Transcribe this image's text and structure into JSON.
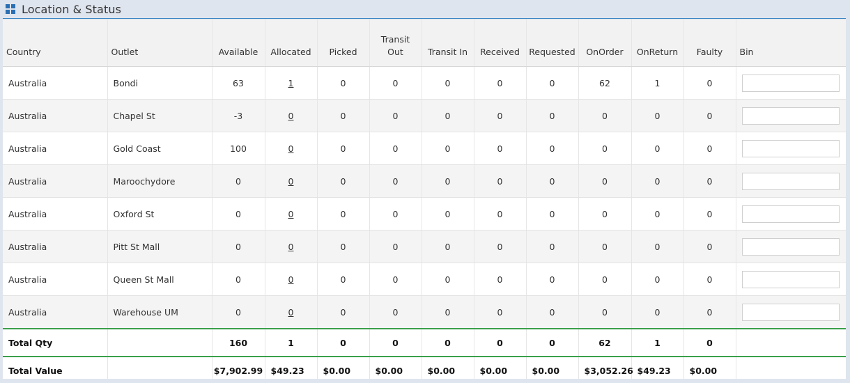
{
  "panel": {
    "title": "Location & Status",
    "icon": "grid-icon"
  },
  "table": {
    "headers": {
      "country": "Country",
      "outlet": "Outlet",
      "available": "Available",
      "allocated": "Allocated",
      "picked": "Picked",
      "transit_out_1": "Transit",
      "transit_out_2": "Out",
      "transit_in": "Transit In",
      "received": "Received",
      "requested": "Requested",
      "onorder": "OnOrder",
      "onreturn": "OnReturn",
      "faulty": "Faulty",
      "bin": "Bin"
    },
    "rows": [
      {
        "country": "Australia",
        "outlet": "Bondi",
        "available": "63",
        "allocated": "1",
        "picked": "0",
        "transit_out": "0",
        "transit_in": "0",
        "received": "0",
        "requested": "0",
        "onorder": "62",
        "onreturn": "1",
        "faulty": "0",
        "bin": ""
      },
      {
        "country": "Australia",
        "outlet": "Chapel St",
        "available": "-3",
        "allocated": "0",
        "picked": "0",
        "transit_out": "0",
        "transit_in": "0",
        "received": "0",
        "requested": "0",
        "onorder": "0",
        "onreturn": "0",
        "faulty": "0",
        "bin": ""
      },
      {
        "country": "Australia",
        "outlet": "Gold Coast",
        "available": "100",
        "allocated": "0",
        "picked": "0",
        "transit_out": "0",
        "transit_in": "0",
        "received": "0",
        "requested": "0",
        "onorder": "0",
        "onreturn": "0",
        "faulty": "0",
        "bin": ""
      },
      {
        "country": "Australia",
        "outlet": "Maroochydore",
        "available": "0",
        "allocated": "0",
        "picked": "0",
        "transit_out": "0",
        "transit_in": "0",
        "received": "0",
        "requested": "0",
        "onorder": "0",
        "onreturn": "0",
        "faulty": "0",
        "bin": ""
      },
      {
        "country": "Australia",
        "outlet": "Oxford St",
        "available": "0",
        "allocated": "0",
        "picked": "0",
        "transit_out": "0",
        "transit_in": "0",
        "received": "0",
        "requested": "0",
        "onorder": "0",
        "onreturn": "0",
        "faulty": "0",
        "bin": ""
      },
      {
        "country": "Australia",
        "outlet": "Pitt St Mall",
        "available": "0",
        "allocated": "0",
        "picked": "0",
        "transit_out": "0",
        "transit_in": "0",
        "received": "0",
        "requested": "0",
        "onorder": "0",
        "onreturn": "0",
        "faulty": "0",
        "bin": ""
      },
      {
        "country": "Australia",
        "outlet": "Queen St Mall",
        "available": "0",
        "allocated": "0",
        "picked": "0",
        "transit_out": "0",
        "transit_in": "0",
        "received": "0",
        "requested": "0",
        "onorder": "0",
        "onreturn": "0",
        "faulty": "0",
        "bin": ""
      },
      {
        "country": "Australia",
        "outlet": "Warehouse UM",
        "available": "0",
        "allocated": "0",
        "picked": "0",
        "transit_out": "0",
        "transit_in": "0",
        "received": "0",
        "requested": "0",
        "onorder": "0",
        "onreturn": "0",
        "faulty": "0",
        "bin": ""
      }
    ],
    "total_qty": {
      "label": "Total Qty",
      "available": "160",
      "allocated": "1",
      "picked": "0",
      "transit_out": "0",
      "transit_in": "0",
      "received": "0",
      "requested": "0",
      "onorder": "62",
      "onreturn": "1",
      "faulty": "0"
    },
    "total_value": {
      "label": "Total Value",
      "available": "$7,902.99",
      "allocated": "$49.23",
      "picked": "$0.00",
      "transit_out": "$0.00",
      "transit_in": "$0.00",
      "received": "$0.00",
      "requested": "$0.00",
      "onorder": "$3,052.26",
      "onreturn": "$49.23",
      "faulty": "$0.00"
    }
  },
  "colors": {
    "accent_line": "#3a85c6",
    "total_line": "#3aa04a",
    "icon": "#2a6fb3"
  }
}
